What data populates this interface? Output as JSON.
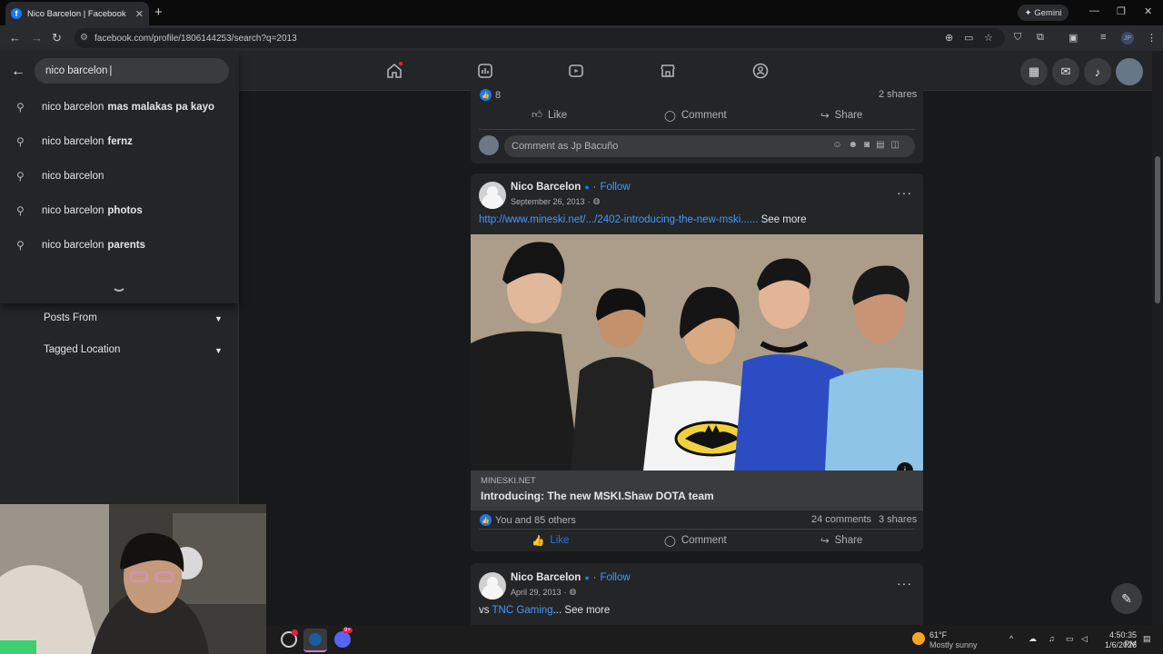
{
  "browser": {
    "tab_title": "Nico Barcelon | Facebook",
    "tab_favicon": "f",
    "new_tab": "+",
    "gemini_label": "Gemini",
    "url": "facebook.com/profile/1806144253/search?q=2013",
    "profile_initials": "JP"
  },
  "search": {
    "query": "nico barcelon",
    "suggestions": [
      {
        "prefix": "nico barcelon",
        "bold": "mas malakas pa kayo"
      },
      {
        "prefix": "nico barcelon",
        "bold": "fernz"
      },
      {
        "prefix": "nico barcelon",
        "bold": ""
      },
      {
        "prefix": "nico barcelon",
        "bold": "photos"
      },
      {
        "prefix": "nico barcelon",
        "bold": "parents"
      }
    ]
  },
  "filters": {
    "posts_from": "Posts From",
    "tagged_location": "Tagged Location"
  },
  "post0": {
    "like_count": "8",
    "shares": "2 shares",
    "like": "Like",
    "comment": "Comment",
    "share": "Share",
    "comment_placeholder": "Comment as Jp Bacuño"
  },
  "post1": {
    "author": "Nico Barcelon",
    "follow": "Follow",
    "date": "September 26, 2013",
    "link_text": "http://www.mineski.net/.../2402-introducing-the-new-mski......",
    "see_more": "See more",
    "link_domain": "MINESKI.NET",
    "link_title": "Introducing: The new MSKI.Shaw DOTA team",
    "reactions": "You and 85 others",
    "comments": "24 comments",
    "shares": "3 shares",
    "like": "Like",
    "comment": "Comment",
    "share": "Share"
  },
  "post2": {
    "author": "Nico Barcelon",
    "follow": "Follow",
    "date": "April 29, 2013",
    "text_prefix": "vs",
    "mention": "TNC Gaming",
    "ellipsis": "...",
    "see_more": "See more"
  },
  "taskbar": {
    "temperature": "61°F",
    "weather": "Mostly sunny",
    "time": "4:50:35 PM",
    "date": "1/6/2026",
    "discord_badge": "9+"
  },
  "colors": {
    "accent": "#1877f2",
    "link": "#4599ff",
    "card_bg": "#242526",
    "page_bg": "#18191a"
  }
}
